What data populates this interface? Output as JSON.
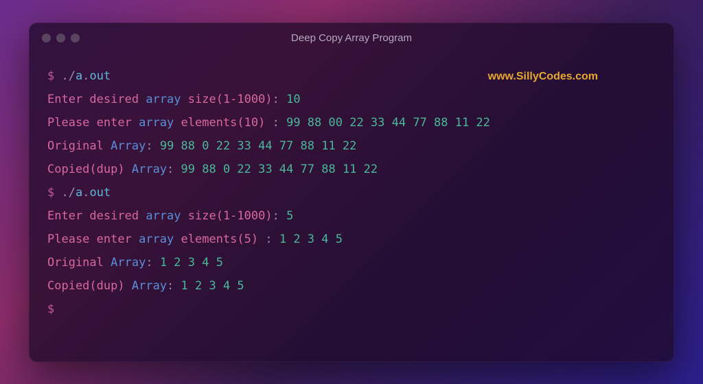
{
  "window": {
    "title": "Deep Copy Array Program"
  },
  "watermark": "www.SillyCodes.com",
  "terminal": {
    "prompt": "$",
    "command": "./a.out",
    "run1": {
      "prompt_size_label": "Enter desired",
      "array_word": "array",
      "size_word": "size",
      "range": "(1-1000)",
      "colon": ":",
      "size_value": "10",
      "enter_label": "Please enter",
      "elements_word": "elements",
      "elements_count": "(10)",
      "space_colon": " :",
      "input_values": "99 88 00 22 33 44 77 88 11 22",
      "original_label": "Original",
      "array_label": "Array",
      "original_values": "99 88 0 22 33 44 77 88 11 22",
      "copied_label": "Copied",
      "dup_label": "(dup)",
      "copied_values": "99 88 0 22 33 44 77 88 11 22"
    },
    "run2": {
      "size_value": "5",
      "elements_count": "(5)",
      "input_values": "1 2 3 4 5",
      "original_values": "1 2 3 4 5",
      "copied_values": "1 2 3 4 5"
    }
  }
}
